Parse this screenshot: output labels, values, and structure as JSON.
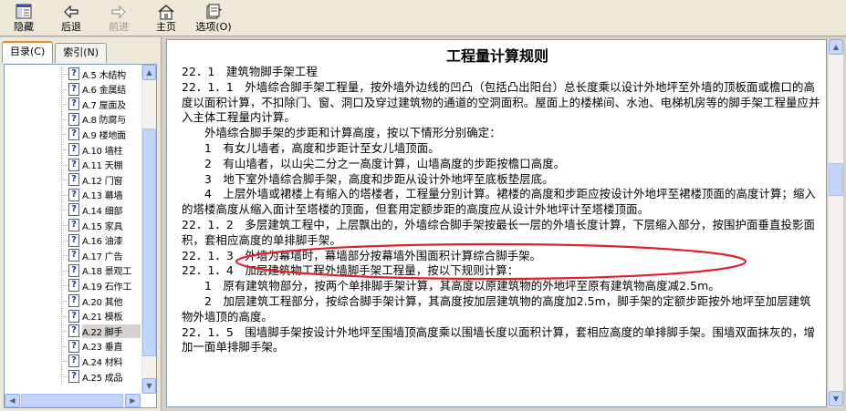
{
  "toolbar": {
    "buttons": [
      {
        "label": "隐藏",
        "icon": "hide-icon",
        "enabled": true
      },
      {
        "label": "后退",
        "icon": "back-arrow-icon",
        "enabled": true
      },
      {
        "label": "前进",
        "icon": "forward-arrow-icon",
        "enabled": false
      },
      {
        "label": "主页",
        "icon": "home-icon",
        "enabled": true
      },
      {
        "label": "选项(O)",
        "icon": "options-icon",
        "enabled": true
      }
    ]
  },
  "left_pane": {
    "tabs": [
      {
        "label": "目录(C)",
        "active": true
      },
      {
        "label": "索引(N)",
        "active": false
      }
    ],
    "tree_items": [
      {
        "label": "A.5 木结构"
      },
      {
        "label": "A.6 金属结"
      },
      {
        "label": "A.7 屋面及"
      },
      {
        "label": "A.8 防腐与"
      },
      {
        "label": "A.9 楼地面"
      },
      {
        "label": "A.10 墙柱"
      },
      {
        "label": "A.11 天棚"
      },
      {
        "label": "A.12 门窗"
      },
      {
        "label": "A.13 幕墙"
      },
      {
        "label": "A.14 细部"
      },
      {
        "label": "A.15 家具"
      },
      {
        "label": "A.16 油漆"
      },
      {
        "label": "A.17 广告"
      },
      {
        "label": "A.18 景观工"
      },
      {
        "label": "A.19 石作工"
      },
      {
        "label": "A.20 其他"
      },
      {
        "label": "A.21 模板"
      },
      {
        "label": "A.22 脚手",
        "selected": true
      },
      {
        "label": "A.23 垂直"
      },
      {
        "label": "A.24 材料"
      },
      {
        "label": "A.25 成品"
      }
    ]
  },
  "document": {
    "title": "工程量计算规则",
    "paragraphs": [
      "22．1　建筑物脚手架工程",
      "22．1．1　外墙综合脚手架工程量，按外墙外边线的凹凸（包括凸出阳台）总长度乘以设计外地坪至外墙的顶板面或檐口的高度以面积计算，不扣除门、窗、洞口及穿过建筑物的通道的空洞面积。屋面上的楼梯间、水池、电梯机房等的脚手架工程量应并入主体工程量内计算。",
      "　　外墙综合脚手架的步距和计算高度，按以下情形分别确定：",
      "　　1　有女儿墙者，高度和步距计至女儿墙顶面。",
      "　　2　有山墙者，以山尖二分之一高度计算，山墙高度的步距按檐口高度。",
      "　　3　地下室外墙综合脚手架，高度和步距从设计外地坪至底板垫层底。",
      "　　4　上层外墙或裙楼上有缩入的塔楼者，工程量分别计算。裙楼的高度和步距应按设计外地坪至裙楼顶面的高度计算；缩入的塔楼高度从缩入面计至塔楼的顶面，但套用定额步距的高度应从设计外地坪计至塔楼顶面。",
      "22．1．2　多层建筑工程中，上层飘出的，外墙综合脚手架按最长一层的外墙长度计算，下层缩入部分，按围护面垂直投影面积，套相应高度的单排脚手架。",
      "22．1．3　外墙为幕墙时，幕墙部分按幕墙外围面积计算综合脚手架。",
      "22．1．4　加层建筑物工程外墙脚手架工程量，按以下规则计算：",
      "　　1　原有建筑物部分，按两个单排脚手架计算，其高度以原建筑物的外地坪至原有建筑物高度减2.5m。",
      "　　2　加层建筑工程部分，按综合脚手架计算，其高度按加层建筑物的高度加2.5m，脚手架的定额步距按外地坪至加层建筑物外墙顶的高度。",
      "22．1．5　围墙脚手架按设计外地坪至围墙顶高度乘以围墙长度以面积计算，套相应高度的单排脚手架。围墙双面抹灰的，增加一面单排脚手架。"
    ]
  },
  "colors": {
    "annotation_ellipse": "#e0202a",
    "tab_highlight": "#e68b2c"
  }
}
